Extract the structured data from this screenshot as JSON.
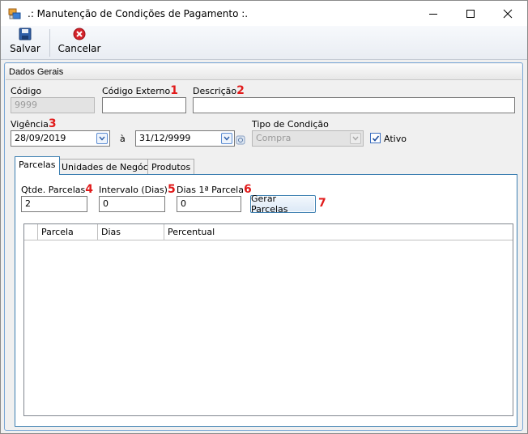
{
  "window": {
    "title": ".: Manutenção de Condições de Pagamento :."
  },
  "toolbar": {
    "save_label": "Salvar",
    "cancel_label": "Cancelar"
  },
  "group": {
    "title": "Dados Gerais"
  },
  "fields": {
    "codigo": {
      "label": "Código",
      "value": "9999"
    },
    "codigo_externo": {
      "label": "Código Externo",
      "marker": "1",
      "value": ""
    },
    "descricao": {
      "label": "Descrição",
      "marker": "2",
      "value": ""
    },
    "vigencia": {
      "label": "Vigência",
      "marker": "3",
      "from": "28/09/2019",
      "separator": "à",
      "to": "31/12/9999"
    },
    "tipo_condicao": {
      "label": "Tipo de Condição",
      "value": "Compra"
    },
    "ativo": {
      "label": "Ativo",
      "checked": true
    }
  },
  "tabs": [
    {
      "label": "Parcelas",
      "active": true
    },
    {
      "label": "Unidades de Negócio",
      "active": false
    },
    {
      "label": "Produtos",
      "active": false
    }
  ],
  "parcelas": {
    "qtde": {
      "label": "Qtde. Parcelas",
      "marker": "4",
      "value": "2"
    },
    "intervalo": {
      "label": "Intervalo (Dias)",
      "marker": "5",
      "value": "0"
    },
    "dias_primeira": {
      "label": "Dias 1ª Parcela",
      "marker": "6",
      "value": "0"
    },
    "gerar": {
      "label": "Gerar Parcelas",
      "marker": "7"
    },
    "grid_columns": [
      "Parcela",
      "Dias",
      "Percentual"
    ]
  },
  "colors": {
    "marker": "#e11b1b",
    "accent_border": "#3c7fb1"
  }
}
